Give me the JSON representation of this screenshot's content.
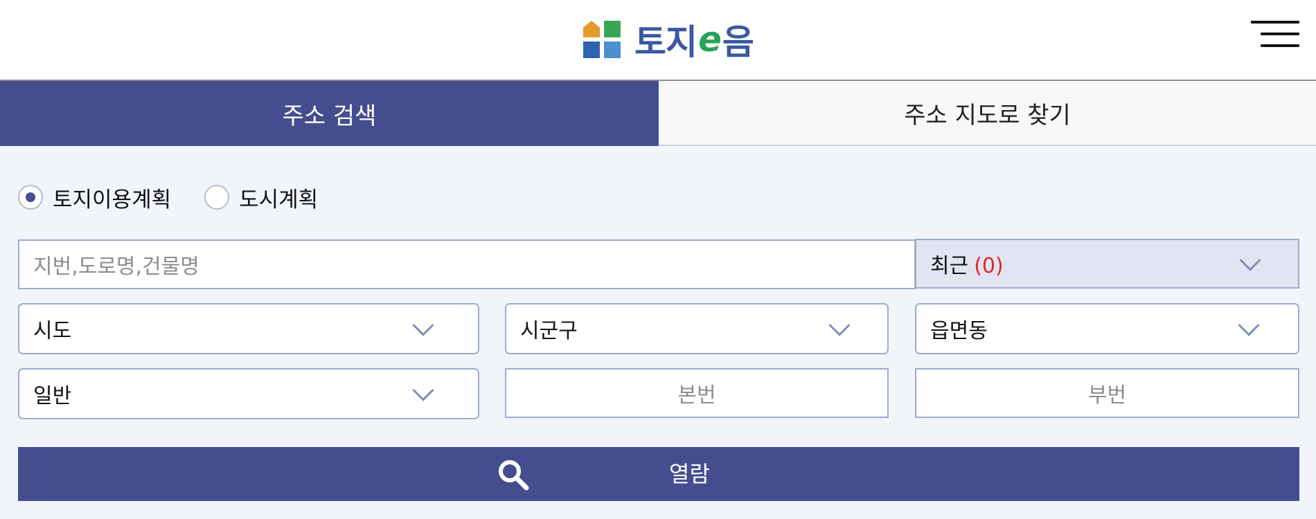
{
  "header": {
    "logo": {
      "text_left": "토지",
      "text_e": "e",
      "text_right": "음"
    }
  },
  "tabs": [
    {
      "label": "주소 검색",
      "active": true
    },
    {
      "label": "주소 지도로 찾기",
      "active": false
    }
  ],
  "plan_type": {
    "options": [
      {
        "label": "토지이용계획",
        "checked": true
      },
      {
        "label": "도시계획",
        "checked": false
      }
    ]
  },
  "search": {
    "placeholder": "지번,도로명,건물명",
    "value": ""
  },
  "recent": {
    "label": "최근",
    "count": "(0)"
  },
  "selects": {
    "sido": "시도",
    "sigungu": "시군구",
    "eupmyeondong": "읍면동",
    "lot_type": "일반"
  },
  "inputs": {
    "main_number_placeholder": "본번",
    "sub_number_placeholder": "부번"
  },
  "view_button": {
    "label": "열람",
    "icon": "search-icon"
  },
  "colors": {
    "primary": "#444e8f",
    "background": "#f1f5fa",
    "recent_count": "#e0262a",
    "field_border": "#9eabd0"
  }
}
